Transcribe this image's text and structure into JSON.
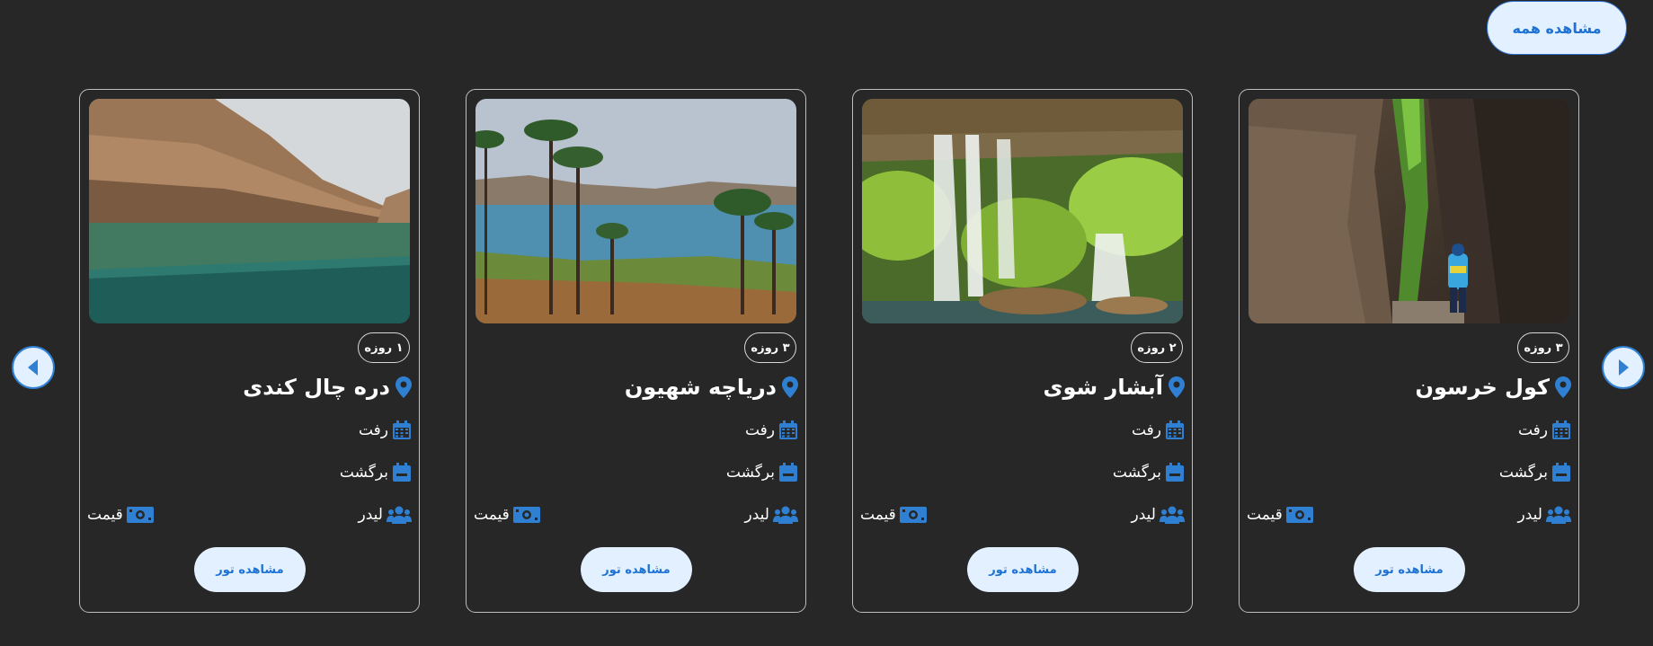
{
  "header": {
    "view_all_label": "مشاهده همه"
  },
  "nav": {
    "prev_icon": "arrow-left-icon",
    "next_icon": "arrow-right-icon"
  },
  "labels": {
    "departure": "رفت",
    "return": "برگشت",
    "leader": "لیدر",
    "price": "قیمت",
    "view_tour": "مشاهده تور"
  },
  "icons": {
    "location": "map-pin-icon",
    "calendar": "calendar-icon",
    "calendar_minus": "calendar-minus-icon",
    "users": "users-icon",
    "money": "money-bill-icon"
  },
  "colors": {
    "background": "#272727",
    "accent": "#2f80d3",
    "button_bg": "#e3f0ff",
    "button_text": "#1d72d3"
  },
  "cards": [
    {
      "title": "کول خرسون",
      "duration": "۳ روزه",
      "photo": "canyon with hiker"
    },
    {
      "title": "آبشار شوی",
      "duration": "۲ روزه",
      "photo": "waterfall"
    },
    {
      "title": "دریاچه شهیون",
      "duration": "۳ روزه",
      "photo": "lake with palm trees"
    },
    {
      "title": "دره چال کندی",
      "duration": "۱ روزه",
      "photo": "river between cliffs"
    }
  ]
}
